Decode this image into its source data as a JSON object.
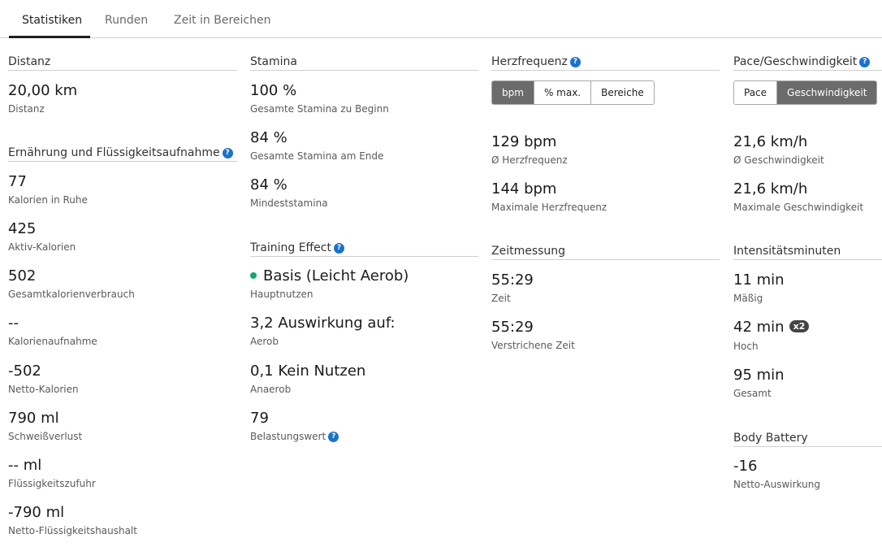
{
  "tabs": [
    "Statistiken",
    "Runden",
    "Zeit in Bereichen"
  ],
  "colors": {
    "help_icon": "#1a73c9",
    "active_segment": "#6b6b6b",
    "training_dot": "#17a673"
  },
  "distance": {
    "title": "Distanz",
    "value": "20,00 km",
    "label": "Distanz"
  },
  "nutrition": {
    "title": "Ernährung und Flüssigkeitsaufnahme",
    "items": [
      {
        "value": "77",
        "label": "Kalorien in Ruhe"
      },
      {
        "value": "425",
        "label": "Aktiv-Kalorien"
      },
      {
        "value": "502",
        "label": "Gesamtkalorienverbrauch"
      },
      {
        "value": "--",
        "label": "Kalorienaufnahme"
      },
      {
        "value": "-502",
        "label": "Netto-Kalorien"
      },
      {
        "value": "790 ml",
        "label": "Schweißverlust"
      },
      {
        "value": "-- ml",
        "label": "Flüssigkeitszufuhr"
      },
      {
        "value": "-790 ml",
        "label": "Netto-Flüssigkeitshaushalt"
      }
    ]
  },
  "stamina": {
    "title": "Stamina",
    "items": [
      {
        "value": "100 %",
        "label": "Gesamte Stamina zu Beginn"
      },
      {
        "value": "84 %",
        "label": "Gesamte Stamina am Ende"
      },
      {
        "value": "84 %",
        "label": "Mindeststamina"
      }
    ]
  },
  "training_effect": {
    "title": "Training Effect",
    "items": [
      {
        "value": "Basis (Leicht Aerob)",
        "label": "Hauptnutzen"
      },
      {
        "value": "3,2 Auswirkung auf:",
        "label": "Aerob"
      },
      {
        "value": "0,1 Kein Nutzen",
        "label": "Anaerob"
      },
      {
        "value": "79",
        "label": "Belastungswert"
      }
    ]
  },
  "heart_rate": {
    "title": "Herzfrequenz",
    "toggle": [
      "bpm",
      "% max.",
      "Bereiche"
    ],
    "items": [
      {
        "value": "129 bpm",
        "label": "Ø Herzfrequenz"
      },
      {
        "value": "144 bpm",
        "label": "Maximale Herzfrequenz"
      }
    ]
  },
  "timing": {
    "title": "Zeitmessung",
    "items": [
      {
        "value": "55:29",
        "label": "Zeit"
      },
      {
        "value": "55:29",
        "label": "Verstrichene Zeit"
      }
    ]
  },
  "pace": {
    "title": "Pace/Geschwindigkeit",
    "toggle": [
      "Pace",
      "Geschwindigkeit"
    ],
    "items": [
      {
        "value": "21,6 km/h",
        "label": "Ø Geschwindigkeit"
      },
      {
        "value": "21,6 km/h",
        "label": "Maximale Geschwindigkeit"
      }
    ]
  },
  "intensity": {
    "title": "Intensitätsminuten",
    "items": [
      {
        "value": "11 min",
        "label": "Mäßig"
      },
      {
        "value": "42 min",
        "label": "Hoch",
        "badge": "x2"
      },
      {
        "value": "95 min",
        "label": "Gesamt"
      }
    ]
  },
  "body_battery": {
    "title": "Body Battery",
    "items": [
      {
        "value": "-16",
        "label": "Netto-Auswirkung"
      }
    ]
  }
}
